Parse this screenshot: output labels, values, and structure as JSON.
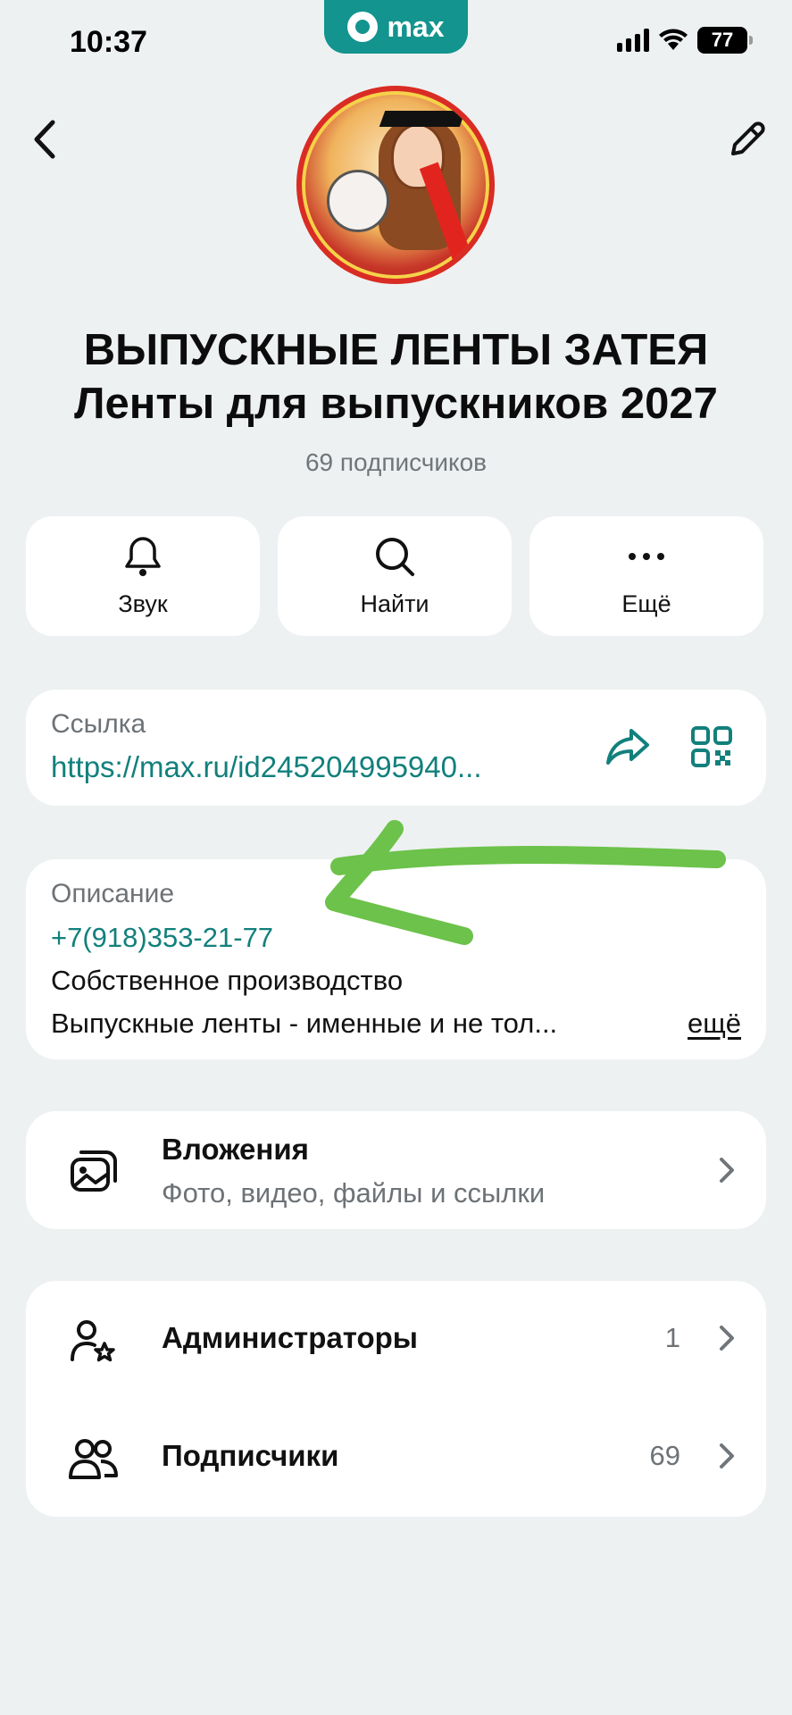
{
  "status_bar": {
    "time": "10:37",
    "app_pill": "max",
    "battery": "77"
  },
  "header": {
    "back_icon": "chevron-left-icon",
    "edit_icon": "pencil-icon"
  },
  "channel": {
    "title_line1": "ВЫПУСКНЫЕ ЛЕНТЫ ЗАТЕЯ",
    "title_line2": "Ленты для выпускников 2027",
    "subscribers": "69 подписчиков"
  },
  "actions": [
    {
      "label": "Звук",
      "icon": "bell-icon"
    },
    {
      "label": "Найти",
      "icon": "search-icon"
    },
    {
      "label": "Ещё",
      "icon": "more-icon"
    }
  ],
  "link": {
    "label": "Ссылка",
    "value": "https://max.ru/id245204995940..."
  },
  "description": {
    "label": "Описание",
    "phone": "+7(918)353-21-77",
    "line1": "Собственное производство",
    "line2": "Выпускные ленты - именные и не тол...",
    "more": "ещё"
  },
  "attachments": {
    "title": "Вложения",
    "subtitle": "Фото, видео, файлы и ссылки"
  },
  "members": [
    {
      "label": "Администраторы",
      "count": "1"
    },
    {
      "label": "Подписчики",
      "count": "69"
    }
  ],
  "colors": {
    "accent": "#12807c",
    "background": "#eef1f2",
    "annotation": "#6cc24a"
  }
}
